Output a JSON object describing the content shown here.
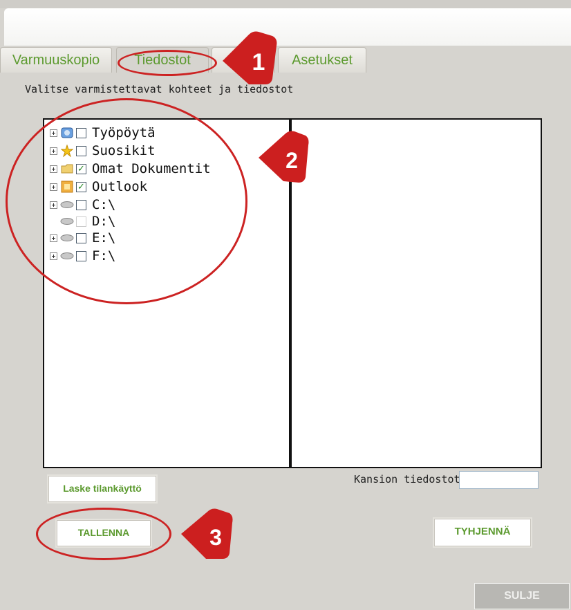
{
  "tabs": [
    {
      "label": "Varmuuskopio",
      "active": false
    },
    {
      "label": "Tiedostot",
      "active": true
    },
    {
      "label": "",
      "active": false
    },
    {
      "label": "Asetukset",
      "active": false
    }
  ],
  "subtitle": "Valitse varmistettavat kohteet ja tiedostot",
  "tree": [
    {
      "label": "Työpöytä",
      "icon": "desktop-icon",
      "expandable": true,
      "checked": false
    },
    {
      "label": "Suosikit",
      "icon": "star-icon",
      "expandable": true,
      "checked": false
    },
    {
      "label": "Omat Dokumentit",
      "icon": "folder-icon",
      "expandable": true,
      "checked": true
    },
    {
      "label": "Outlook",
      "icon": "outlook-icon",
      "expandable": true,
      "checked": true
    },
    {
      "label": "C:\\",
      "icon": "drive-icon",
      "expandable": true,
      "checked": false
    },
    {
      "label": "D:\\",
      "icon": "drive-icon",
      "expandable": false,
      "checked": false,
      "disabled": true
    },
    {
      "label": "E:\\",
      "icon": "drive-icon",
      "expandable": true,
      "checked": false
    },
    {
      "label": "F:\\",
      "icon": "drive-icon",
      "expandable": true,
      "checked": false
    }
  ],
  "buttons": {
    "calculate": "Laske tilankäyttö",
    "save": "TALLENNA",
    "clear": "TYHJENNÄ",
    "close": "SULJE"
  },
  "folder_files": {
    "label": "Kansion tiedostot:",
    "value": ""
  },
  "callouts": [
    "1",
    "2",
    "3"
  ],
  "colors": {
    "accent": "#5c9a2f",
    "annotation": "#cc2222",
    "background": "#d6d4cf"
  }
}
